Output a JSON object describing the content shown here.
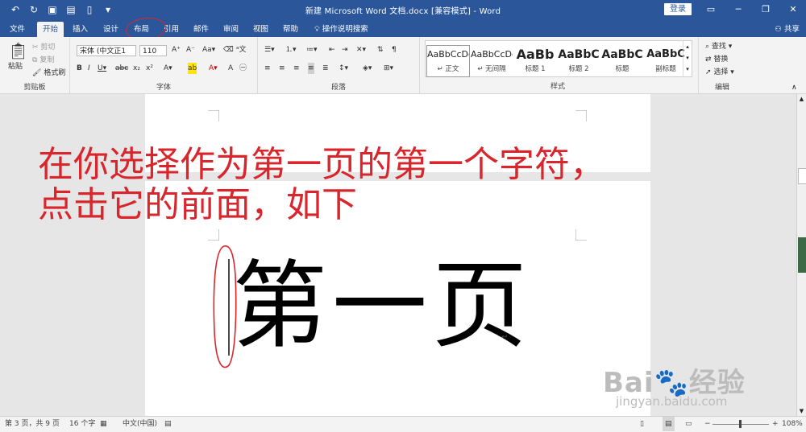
{
  "window": {
    "title": "新建 Microsoft Word 文档.docx [兼容模式] - Word",
    "login_label": "登录",
    "controls": [
      "ribbon-display",
      "minimize",
      "restore",
      "close"
    ]
  },
  "quick_access": [
    "undo-icon",
    "redo-icon",
    "save-icon",
    "template-icon",
    "new-doc-icon",
    "customize-icon"
  ],
  "tabs": {
    "file": "文件",
    "home": "开始",
    "insert": "插入",
    "design": "设计",
    "layout": "布局",
    "references": "引用",
    "mailings": "邮件",
    "review": "审阅",
    "view": "视图",
    "help": "帮助",
    "tell_me": "操作说明搜索",
    "share": "共享"
  },
  "ribbon": {
    "clipboard": {
      "paste": "粘贴",
      "cut": "剪切",
      "copy": "复制",
      "format_painter": "格式刷",
      "label": "剪贴板"
    },
    "font": {
      "font_name": "宋体 (中文正1",
      "font_size": "110",
      "label": "字体"
    },
    "paragraph": {
      "label": "段落"
    },
    "styles": {
      "items": [
        {
          "sample": "AaBbCcDd",
          "name": "↵ 正文"
        },
        {
          "sample": "AaBbCcDd",
          "name": "↵ 无间隔"
        },
        {
          "sample": "AaBb",
          "name": "标题 1"
        },
        {
          "sample": "AaBbC",
          "name": "标题 2"
        },
        {
          "sample": "AaBbC",
          "name": "标题"
        },
        {
          "sample": "AaBbC",
          "name": "副标题"
        }
      ],
      "label": "样式"
    },
    "editing": {
      "find": "查找",
      "replace": "替换",
      "select": "选择",
      "label": "编辑"
    }
  },
  "document": {
    "annotation_line1": "在你选择作为第一页的第一个字符，",
    "annotation_line2": "点击它的前面，如下",
    "big_text": "第一页",
    "return_mark": "↵",
    "annotation_color": "#d8262c"
  },
  "status_bar": {
    "page": "第 3 页，共 9 页",
    "words": "16 个字",
    "language": "中文(中国)",
    "zoom": "108%"
  },
  "watermark": {
    "brand": "Bai🐾经验",
    "url": "jingyan.baidu.com"
  }
}
